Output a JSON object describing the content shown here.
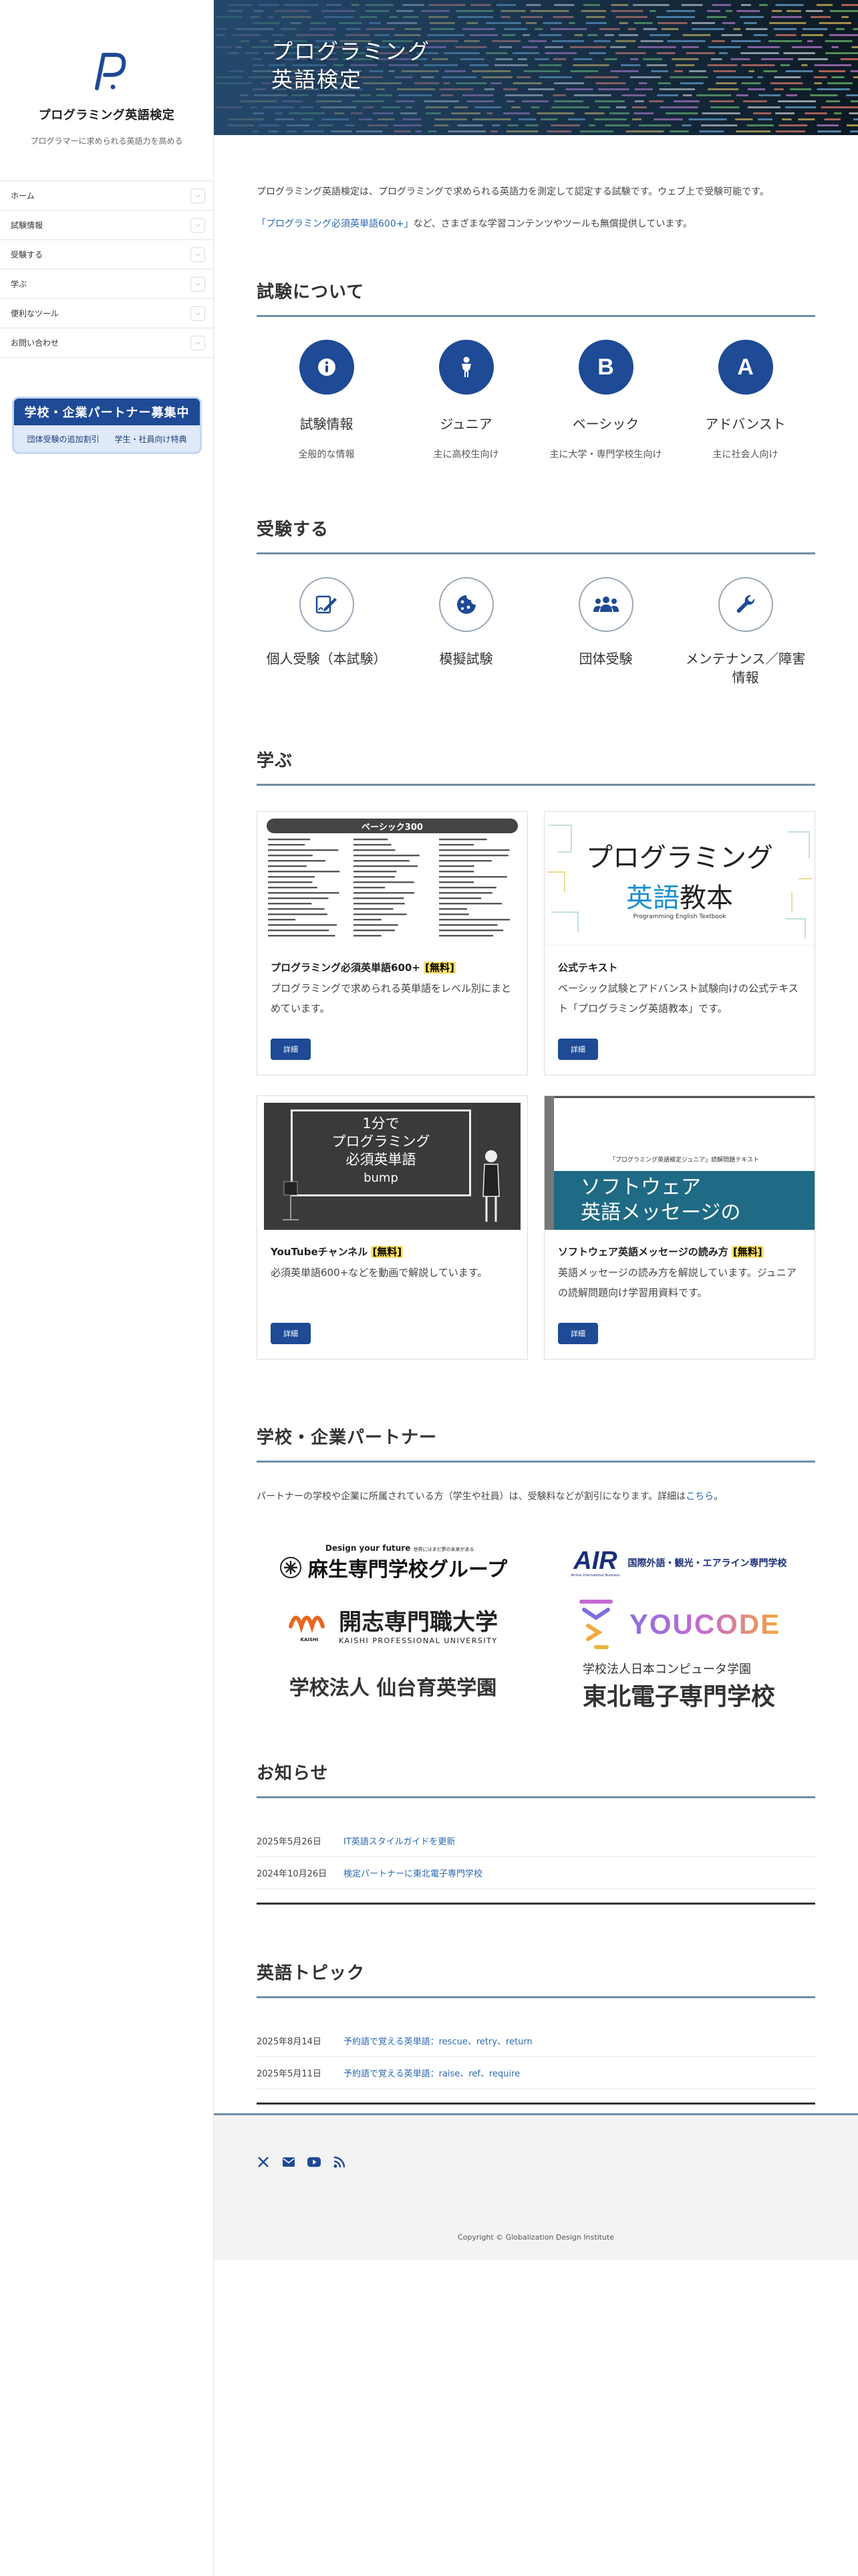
{
  "site": {
    "title": "プログラミング英語検定",
    "tagline": "プログラマーに求められる英語力を高める"
  },
  "nav": [
    {
      "label": "ホーム"
    },
    {
      "label": "試験情報"
    },
    {
      "label": "受験する"
    },
    {
      "label": "学ぶ"
    },
    {
      "label": "便利なツール"
    },
    {
      "label": "お問い合わせ"
    }
  ],
  "recruit": {
    "title": "学校・企業パートナー募集中",
    "sub1": "団体受験の追加割引",
    "sub2": "学生・社員向け特典"
  },
  "hero": {
    "line1": "プログラミング",
    "line2": "英語検定"
  },
  "intro": {
    "p1": "プログラミング英語検定は、プログラミングで求められる英語力を測定して認定する試験です。ウェブ上で受験可能です。",
    "p2_link": "「プログラミング必須英単語600+」",
    "p2_rest": "など、さまざまな学習コンテンツやツールも無償提供しています。"
  },
  "about": {
    "heading": "試験について",
    "items": [
      {
        "icon": "info-icon",
        "label": "試験情報",
        "sub": "全般的な情報"
      },
      {
        "icon": "child-icon",
        "label": "ジュニア",
        "sub": "主に高校生向け"
      },
      {
        "icon": "letter-b-icon",
        "label": "ベーシック",
        "sub": "主に大学・専門学校生向け"
      },
      {
        "icon": "letter-a-icon",
        "label": "アドバンスト",
        "sub": "主に社会人向け"
      }
    ],
    "letter_b": "B",
    "letter_a": "A"
  },
  "take": {
    "heading": "受験する",
    "items": [
      {
        "icon": "signature-icon",
        "label": "個人受験（本試験）"
      },
      {
        "icon": "cookie-icon",
        "label": "模擬試験"
      },
      {
        "icon": "users-icon",
        "label": "団体受験"
      },
      {
        "icon": "wrench-icon",
        "label": "メンテナンス／障害情報"
      }
    ]
  },
  "learn": {
    "heading": "学ぶ",
    "cards": [
      {
        "title": "プログラミング必須英単語600+",
        "badge": "[無料]",
        "text": "プログラミングで求められる英単語をレベル別にまとめています。",
        "button": "詳細",
        "img_title": "ベーシック300"
      },
      {
        "title": "公式テキスト",
        "badge": "",
        "text": "ベーシック試験とアドバンスト試験向けの公式テキスト「プログラミング英語教本」です。",
        "button": "詳細",
        "img_line1": "プログラミング",
        "img_line2a": "英語",
        "img_line2b": "教本",
        "img_sub": "Programming English Textbook"
      },
      {
        "title": "YouTubeチャンネル",
        "badge": "[無料]",
        "text": "必須英単語600+などを動画で解説しています。",
        "button": "詳細",
        "img_line1": "1分で",
        "img_line2": "プログラミング",
        "img_line3": "必須英単語",
        "img_line4": "bump"
      },
      {
        "title": "ソフトウェア英語メッセージの",
        "title2": "読み方",
        "badge": "[無料]",
        "text": "英語メッセージの読み方を解説しています。ジュニアの読解問題向け学習用資料です。",
        "button": "詳細",
        "img_caption": "「プログラミング英語検定ジュニア」読解問題テキスト",
        "img_line1": "ソフトウェア",
        "img_line2": "英語メッセージの"
      }
    ]
  },
  "partners": {
    "heading": "学校・企業パートナー",
    "text": "パートナーの学校や企業に所属されている方（学生や社員）は、受験料などが割引になります。詳細は",
    "link": "こちら",
    "text_end": "。",
    "logos": {
      "aso_top": "Design your future",
      "aso_top_jp": "世界にはまだ夢の未来がある",
      "aso": "麻生専門学校グループ",
      "air": "AIR",
      "air_jp": "国際外語・観光・エアライン専門学校",
      "air_en": "Airline International Business",
      "kaishi": "開志専門職大学",
      "kaishi_en": "KAISHI PROFESSIONAL UNIVERSITY",
      "kaishi_mark": "KAISHI",
      "youcode": "YOUCODE",
      "sendai": "学校法人 仙台育英学園",
      "tohoku_top": "学校法人日本コンピュータ学園",
      "tohoku": "東北電子専門学校"
    }
  },
  "news": {
    "heading": "お知らせ",
    "items": [
      {
        "date": "2025年5月26日",
        "title": "IT英語スタイルガイドを更新"
      },
      {
        "date": "2024年10月26日",
        "title": "検定パートナーに東北電子専門学校"
      }
    ]
  },
  "topics": {
    "heading": "英語トピック",
    "items": [
      {
        "date": "2025年8月14日",
        "title": "予約語で覚える英単語：rescue、retry、return"
      },
      {
        "date": "2025年5月11日",
        "title": "予約語で覚える英単語：raise、ref、require"
      }
    ]
  },
  "footer": {
    "copyright": "Copyright © Globalization Design Institute",
    "social": [
      "x-icon",
      "envelope-icon",
      "youtube-icon",
      "rss-icon"
    ]
  },
  "colors": {
    "brand": "#1e4a96",
    "rule": "#6d8fa6",
    "link": "#2a69b0",
    "highlight": "#ffe16a"
  }
}
